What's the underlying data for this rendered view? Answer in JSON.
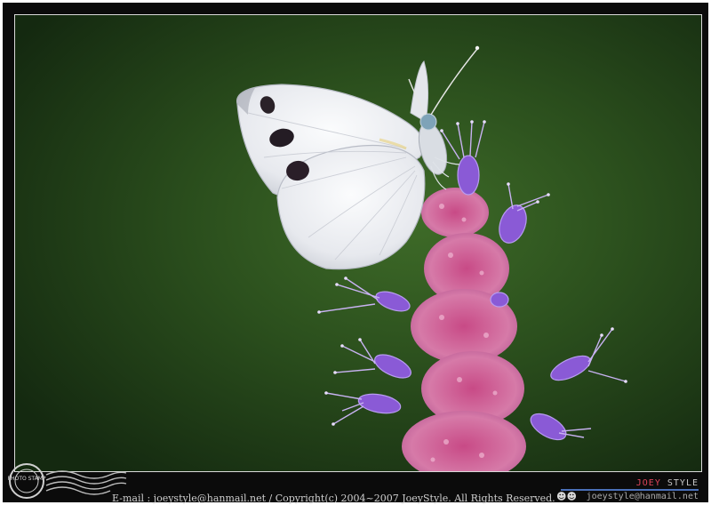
{
  "footer": {
    "copyright": "E-mail : joeystyle@hanmail.net / Copyright(c) 2004~2007 JoeyStyle. All Rights Reserved."
  },
  "stamp": {
    "label": "PHOTO STAMP"
  },
  "brand": {
    "logo_left": "JOEY",
    "logo_right": "STYLE",
    "email": "joeystyle@hanmail.net",
    "people_icon": "☻☻"
  },
  "colors": {
    "frame": "#0b0b0b",
    "background_green": "#2f5a1e",
    "butterfly_white": "#eef0f4",
    "flower_purple": "#9a6ad8",
    "flower_pink": "#d35f9a",
    "brand_accent": "#e0445a"
  },
  "subjects": {
    "main": "butterfly-icon",
    "secondary": "flower-icon"
  }
}
